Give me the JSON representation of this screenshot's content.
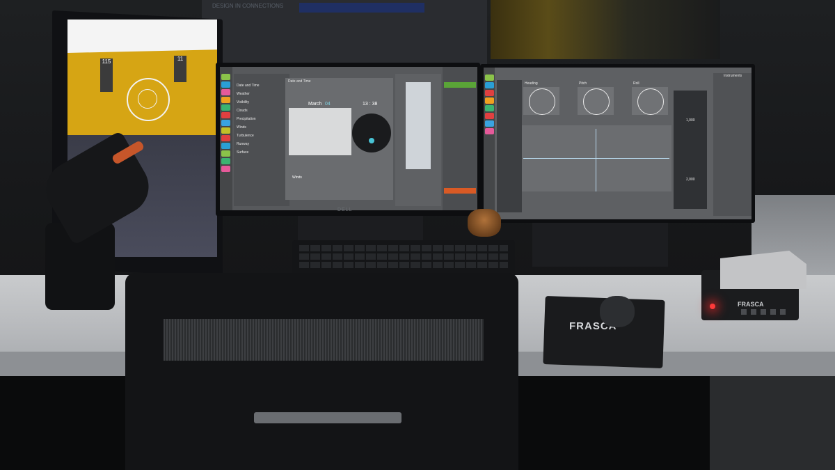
{
  "scene": {
    "poster": {
      "text": "DESIGN IN CONNECTIONS"
    },
    "left_monitor": {
      "instrument_values": [
        "115",
        "11"
      ]
    },
    "center_monitor": {
      "brand": "DELL",
      "panel_title": "Date and Time",
      "month": "March",
      "day": "04",
      "time": "13 : 38",
      "section_label": "Winds",
      "nav_items": [
        "Date and Time",
        "Weather",
        "Visibility",
        "Clouds",
        "Precipitation",
        "Winds",
        "Turbulence",
        "Runway",
        "Surface"
      ],
      "category_colors": [
        "#8bc34a",
        "#2a9fd6",
        "#e65a9a",
        "#f0a020",
        "#3cb371",
        "#e04040",
        "#3aa3e0",
        "#c0c028",
        "#e04040",
        "#2a9fd6",
        "#8bc34a",
        "#3cb371",
        "#e65a9a"
      ]
    },
    "right_monitor": {
      "panel_title": "Instruments",
      "gauges": [
        "Heading",
        "Pitch",
        "Roll"
      ],
      "readouts": [
        "1,000",
        "2,000"
      ],
      "category_colors": [
        "#8bc34a",
        "#2a9fd6",
        "#e04040",
        "#f0a020",
        "#3cb371",
        "#e04040",
        "#3aa3e0",
        "#e65a9a"
      ]
    },
    "mousepad": {
      "brand": "FRASCA"
    },
    "device": {
      "brand": "FRASCA"
    }
  }
}
